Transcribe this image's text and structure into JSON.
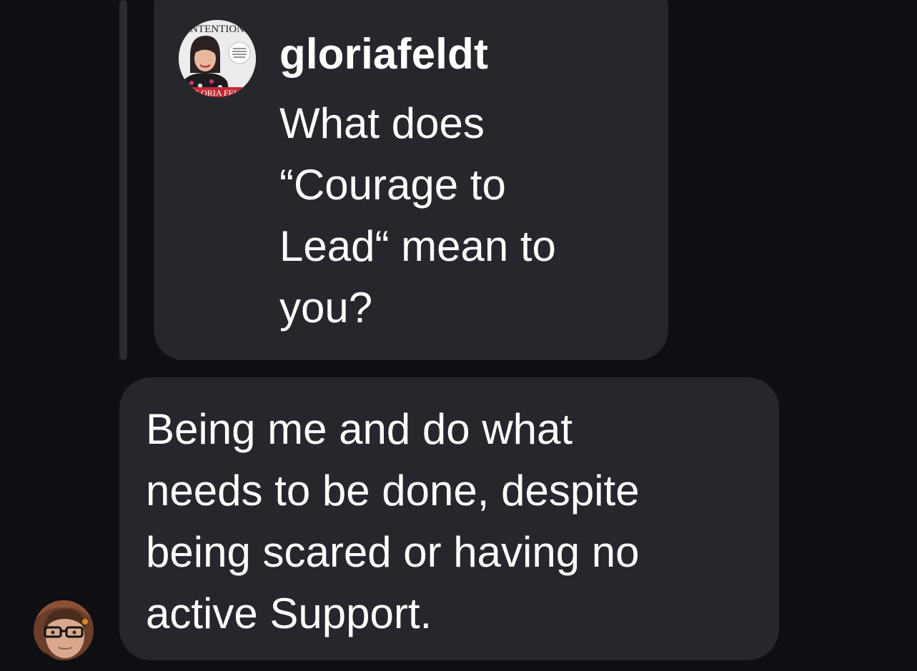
{
  "thread": {
    "quoted_message": {
      "author": "gloriafeldt",
      "text": "What does\n“Courage to\nLead“ mean to\nyou?",
      "avatar_icon": "magazine-cover-avatar",
      "avatar_badge_text": "INTENTIONI",
      "avatar_footer_text": "GLORIA FELD"
    },
    "reply_message": {
      "text": "Being me and do what\nneeds to be done, despite\nbeing scared or having no\nactive Support.",
      "avatar_icon": "user-avatar"
    },
    "colors": {
      "background": "#0d0f13",
      "bubble": "#25272c",
      "text": "#ffffff",
      "reply_bar": "#2a2c31"
    }
  }
}
